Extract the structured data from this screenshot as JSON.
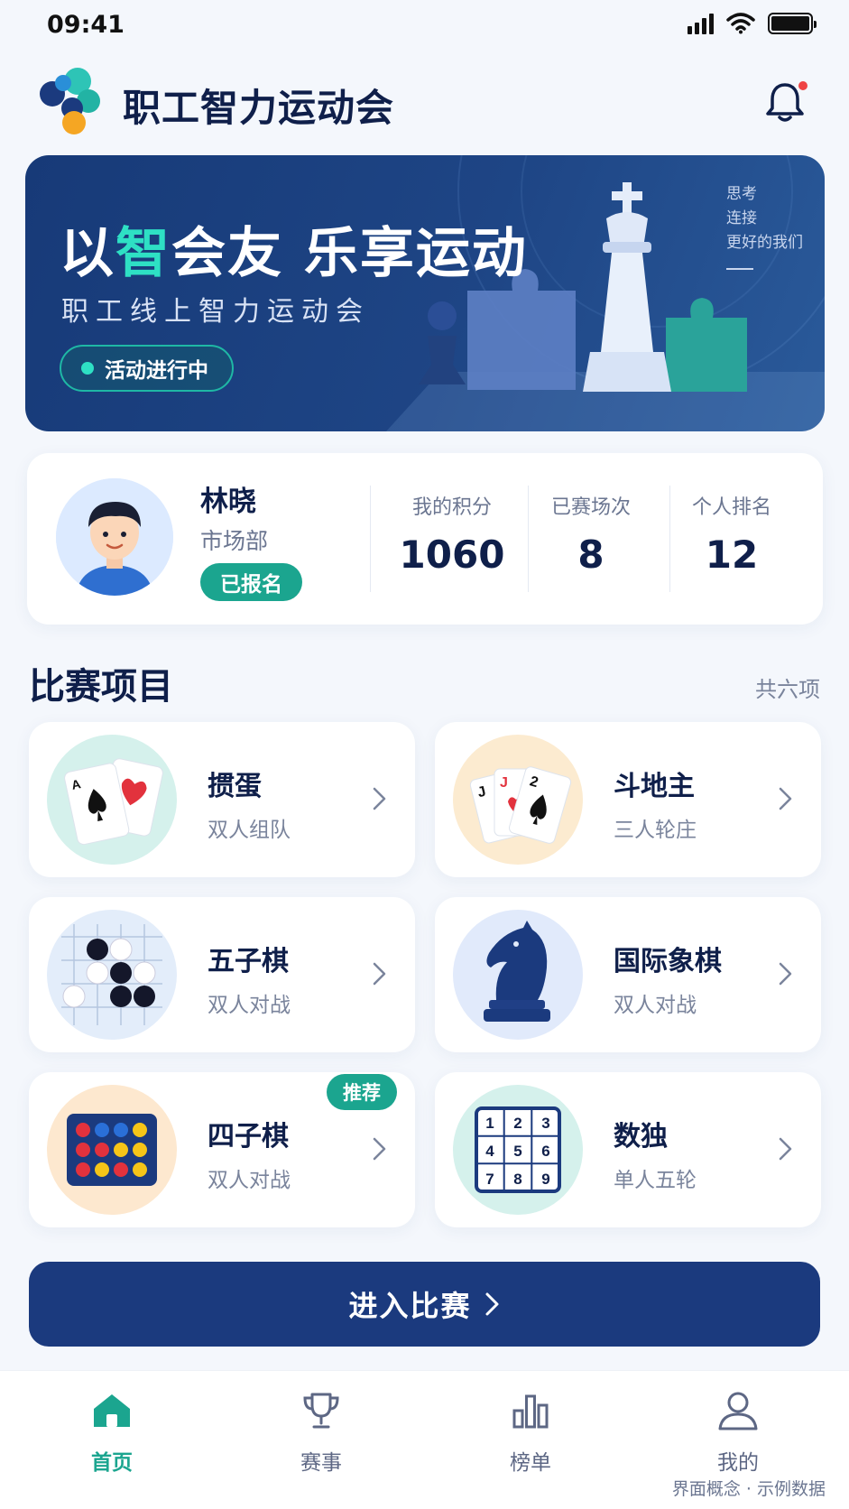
{
  "status_bar": {
    "time": "09:41"
  },
  "header": {
    "title": "职工智力运动会"
  },
  "banner": {
    "title_prefix": "以",
    "title_accent": "智",
    "title_suffix": "会友  乐享运动",
    "subtitle": "职工线上智力运动会",
    "pill": "活动进行中",
    "side_lines": [
      "思考",
      "连接",
      "更好的我们"
    ]
  },
  "profile": {
    "name": "林晓",
    "department": "市场部",
    "badge": "已报名",
    "stats": [
      {
        "label": "我的积分",
        "value": "1060"
      },
      {
        "label": "已赛场次",
        "value": "8"
      },
      {
        "label": "个人排名",
        "value": "12"
      }
    ]
  },
  "section": {
    "title": "比赛项目",
    "count": "共六项"
  },
  "games": [
    {
      "name": "掼蛋",
      "desc": "双人组队",
      "icon": "playing-cards-icon"
    },
    {
      "name": "斗地主",
      "desc": "三人轮庄",
      "icon": "poker-hand-icon"
    },
    {
      "name": "五子棋",
      "desc": "双人对战",
      "icon": "gomoku-icon"
    },
    {
      "name": "国际象棋",
      "desc": "双人对战",
      "icon": "chess-knight-icon"
    },
    {
      "name": "四子棋",
      "desc": "双人对战",
      "icon": "connect-four-icon",
      "tag": "推荐"
    },
    {
      "name": "数独",
      "desc": "单人五轮",
      "icon": "sudoku-icon"
    }
  ],
  "cta": {
    "label": "进入比赛"
  },
  "tabs": [
    {
      "label": "首页",
      "icon": "home-icon",
      "active": true
    },
    {
      "label": "赛事",
      "icon": "trophy-icon"
    },
    {
      "label": "榜单",
      "icon": "bar-chart-icon"
    },
    {
      "label": "我的",
      "icon": "user-icon"
    }
  ],
  "footnote": "界面概念 · 示例数据",
  "colors": {
    "primary": "#1b3a7e",
    "accent": "#1ba58f",
    "highlight": "#2ee0c4",
    "notification": "#ef4444"
  }
}
